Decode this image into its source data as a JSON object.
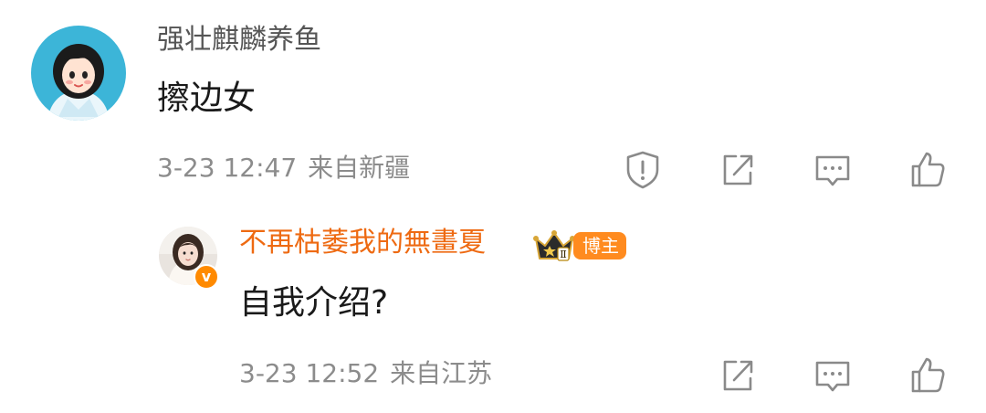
{
  "comment": {
    "username": "强壮麒麟养鱼",
    "text": "擦边女",
    "time": "3-23 12:47",
    "location": "来自新疆",
    "avatar_icon": "cartoon-girl-avatar",
    "actions": [
      "report-icon",
      "share-icon",
      "comment-icon",
      "like-icon"
    ]
  },
  "reply": {
    "username": "不再枯萎我的無畫夏",
    "badge_label": "博主",
    "crown_level": "Ⅱ",
    "verified_mark": "v",
    "text": "自我介绍?",
    "time": "3-23 12:52",
    "location": "来自江苏",
    "avatar_icon": "photo-avatar",
    "actions": [
      "share-icon",
      "comment-icon",
      "like-icon"
    ]
  },
  "colors": {
    "username_gray": "#555555",
    "blogger_orange": "#ee6a12",
    "meta_gray": "#8c8c8c",
    "icon_gray": "#8a8a8a",
    "badge_orange": "#ff8b1f"
  }
}
